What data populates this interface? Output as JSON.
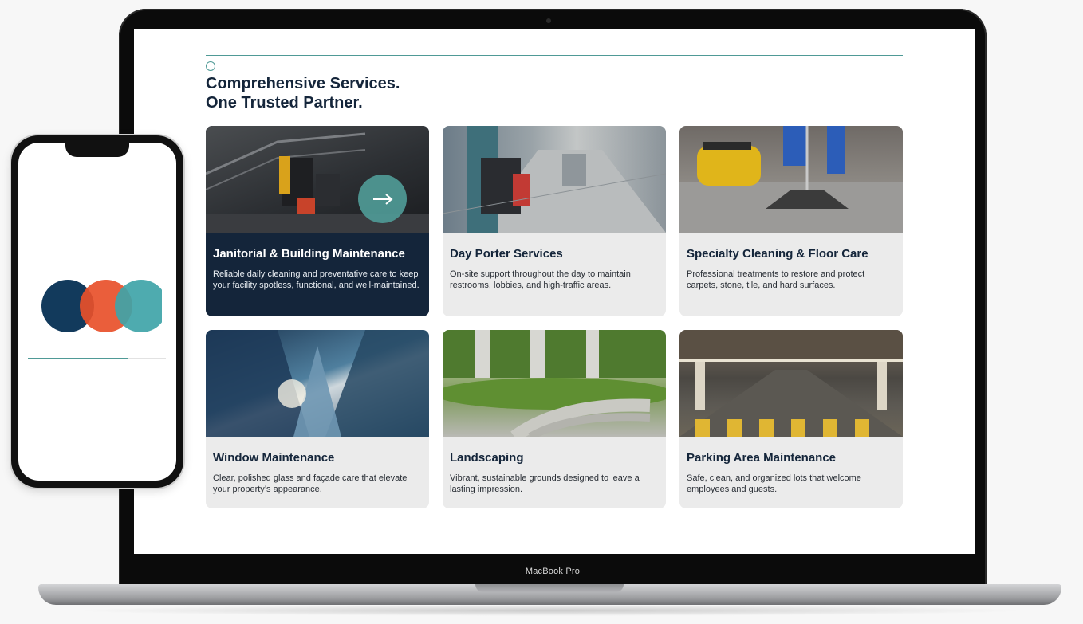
{
  "device": {
    "laptop_brand": "MacBook Pro"
  },
  "page": {
    "heading_line1": "Comprehensive Services.",
    "heading_line2": "One Trusted Partner."
  },
  "services": [
    {
      "title": "Janitorial & Building Maintenance",
      "desc": "Reliable daily cleaning and preventative care to keep your facility spotless, functional, and well-maintained.",
      "active": true
    },
    {
      "title": "Day Porter Services",
      "desc": "On-site support throughout the day to maintain restrooms, lobbies, and high-traffic areas.",
      "active": false
    },
    {
      "title": "Specialty Cleaning & Floor Care",
      "desc": "Professional treatments to restore and protect carpets, stone, tile, and hard surfaces.",
      "active": false
    },
    {
      "title": "Window Maintenance",
      "desc": "Clear, polished glass and façade care that elevate your property’s appearance.",
      "active": false
    },
    {
      "title": "Landscaping",
      "desc": "Vibrant, sustainable grounds designed to leave a lasting impression.",
      "active": false
    },
    {
      "title": "Parking Area Maintenance",
      "desc": "Safe, clean, and organized lots that welcome employees and guests.",
      "active": false
    }
  ],
  "phone": {
    "loading_progress": 0.72
  },
  "colors": {
    "navy": "#14253a",
    "teal": "#4f9a96",
    "orange": "#e8502a",
    "dark_blue": "#123a5c"
  }
}
